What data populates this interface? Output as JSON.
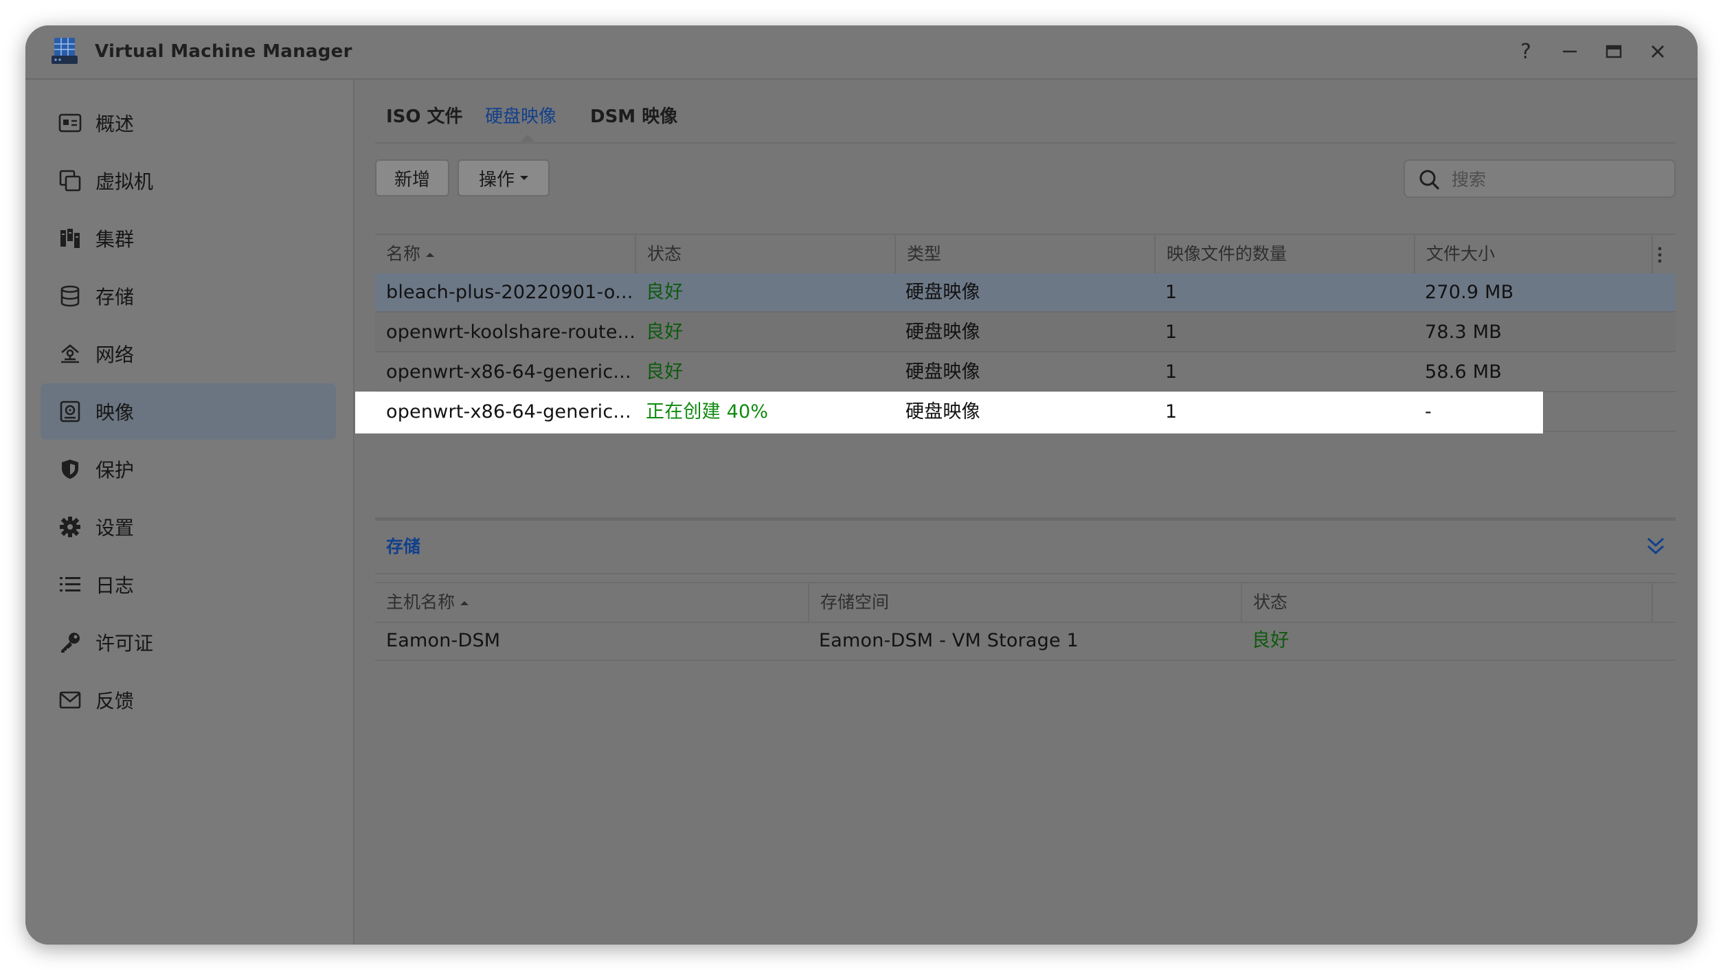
{
  "app": {
    "title": "Virtual Machine Manager",
    "controls": [
      "?",
      "—",
      "▭",
      "✕"
    ]
  },
  "sidebar": {
    "items": [
      {
        "label": "概述",
        "icon": "overview-card-icon"
      },
      {
        "label": "虚拟机",
        "icon": "vm-copy-icon"
      },
      {
        "label": "集群",
        "icon": "cluster-icon"
      },
      {
        "label": "存储",
        "icon": "database-icon"
      },
      {
        "label": "网络",
        "icon": "network-icon"
      },
      {
        "label": "映像",
        "icon": "disk-image-icon",
        "active": true
      },
      {
        "label": "保护",
        "icon": "shield-icon"
      },
      {
        "label": "设置",
        "icon": "gear-icon"
      },
      {
        "label": "日志",
        "icon": "list-icon"
      },
      {
        "label": "许可证",
        "icon": "key-icon"
      },
      {
        "label": "反馈",
        "icon": "mail-icon"
      }
    ]
  },
  "tabs": [
    {
      "label": "ISO 文件"
    },
    {
      "label": "硬盘映像",
      "active": true
    },
    {
      "label": "DSM 映像"
    }
  ],
  "toolbar": {
    "add_label": "新增",
    "action_label": "操作",
    "search_placeholder": "搜索"
  },
  "images_table": {
    "columns": [
      "名称",
      "状态",
      "类型",
      "映像文件的数量",
      "文件大小"
    ],
    "rows": [
      {
        "name": "bleach-plus-20220901-o...",
        "status": "良好",
        "type": "硬盘映像",
        "count": "1",
        "size": "270.9 MB"
      },
      {
        "name": "openwrt-koolshare-route...",
        "status": "良好",
        "type": "硬盘映像",
        "count": "1",
        "size": "78.3 MB"
      },
      {
        "name": "openwrt-x86-64-generic...",
        "status": "良好",
        "type": "硬盘映像",
        "count": "1",
        "size": "58.6 MB"
      },
      {
        "name": "openwrt-x86-64-generic...",
        "status": "正在创建 40%",
        "type": "硬盘映像",
        "count": "1",
        "size": "-"
      }
    ]
  },
  "storage_panel": {
    "title": "存储",
    "columns": [
      "主机名称",
      "存储空间",
      "状态"
    ],
    "rows": [
      {
        "host": "Eamon-DSM",
        "volume": "Eamon-DSM - VM Storage 1",
        "status": "良好"
      }
    ]
  },
  "colors": {
    "accent": "#12408c",
    "status_ok": "#0d5a0d",
    "status_progress": "#0f8a0f"
  }
}
